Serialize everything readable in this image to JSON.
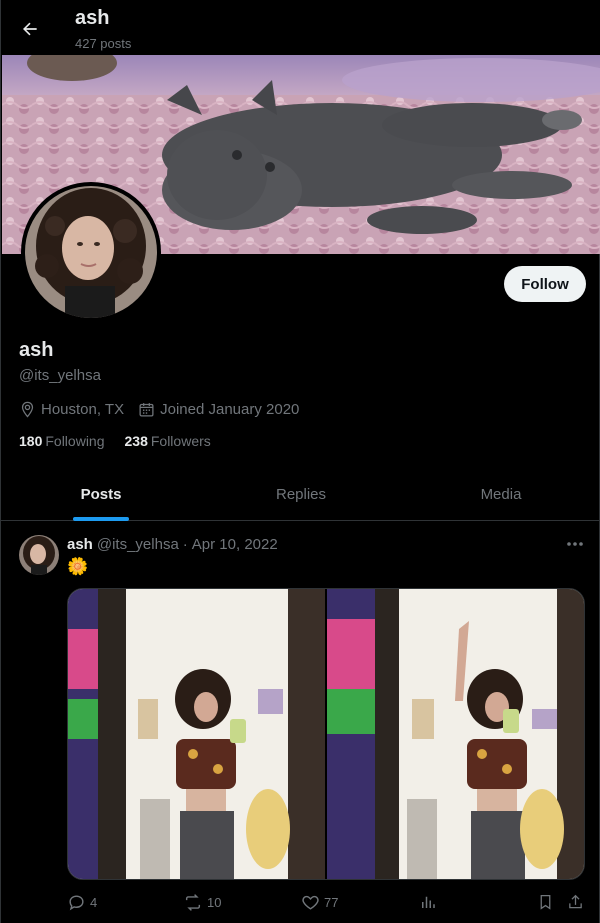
{
  "header": {
    "title": "ash",
    "subtitle": "427 posts"
  },
  "profile": {
    "display_name": "ash",
    "handle": "@its_yelhsa",
    "location": "Houston, TX",
    "joined": "Joined January 2020",
    "following_count": "180",
    "following_label": "Following",
    "followers_count": "238",
    "followers_label": "Followers",
    "follow_label": "Follow"
  },
  "tabs": [
    {
      "label": "Posts",
      "active": true
    },
    {
      "label": "Replies",
      "active": false
    },
    {
      "label": "Media",
      "active": false
    }
  ],
  "post": {
    "author": "ash",
    "handle": "@its_yelhsa",
    "separator": "·",
    "date": "Apr 10, 2022",
    "text": "🌼",
    "replies": "4",
    "reposts": "10",
    "likes": "77"
  },
  "icons": {
    "back": "arrow-left-icon",
    "location": "map-pin-icon",
    "calendar": "calendar-icon",
    "more": "more-horizontal-icon",
    "reply": "reply-icon",
    "repost": "repost-icon",
    "like": "heart-icon",
    "views": "analytics-icon",
    "bookmark": "bookmark-icon",
    "share": "share-icon"
  },
  "colors": {
    "background": "#000000",
    "accent": "#1d9bf0",
    "text": "#e7e9ea",
    "muted": "#71767b",
    "border": "#2f3336"
  }
}
